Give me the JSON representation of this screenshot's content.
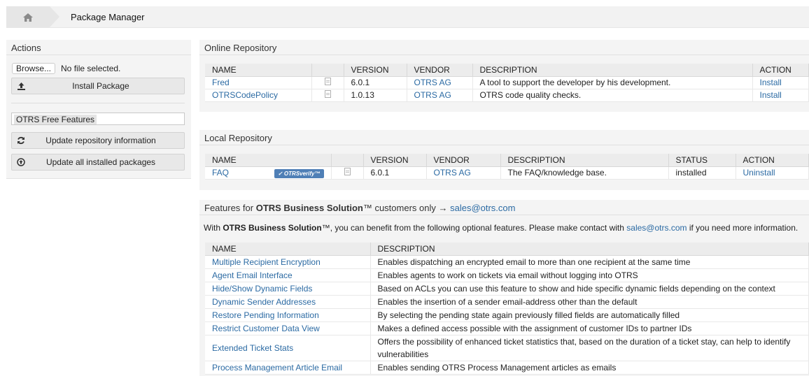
{
  "breadcrumb": {
    "title": "Package Manager",
    "home_icon": "home-icon"
  },
  "sidebar": {
    "title": "Actions",
    "browse_label": "Browse...",
    "no_file": "No file selected.",
    "install_label": "Install Package",
    "repo_select": "OTRS Free Features",
    "update_repo_label": "Update repository information",
    "update_all_label": "Update all installed packages"
  },
  "online": {
    "title": "Online Repository",
    "headers": [
      "NAME",
      "",
      "VERSION",
      "VENDOR",
      "DESCRIPTION",
      "ACTION"
    ],
    "rows": [
      {
        "name": "Fred",
        "version": "6.0.1",
        "vendor": "OTRS AG",
        "description": "A tool to support the developer by his development.",
        "action": "Install"
      },
      {
        "name": "OTRSCodePolicy",
        "version": "1.0.13",
        "vendor": "OTRS AG",
        "description": "OTRS code quality checks.",
        "action": "Install"
      }
    ]
  },
  "local": {
    "title": "Local Repository",
    "headers": [
      "NAME",
      "",
      "VERSION",
      "VENDOR",
      "DESCRIPTION",
      "STATUS",
      "ACTION"
    ],
    "rows": [
      {
        "name": "FAQ",
        "badge": "✓ OTRSverify™",
        "version": "6.0.1",
        "vendor": "OTRS AG",
        "description": "The FAQ/knowledge base.",
        "status": "installed",
        "action": "Uninstall"
      }
    ]
  },
  "features": {
    "title_prefix": "Features for ",
    "title_bold": "OTRS Business Solution",
    "title_suffix": "™ customers only → ",
    "title_link": "sales@otrs.com",
    "intro_prefix": "With ",
    "intro_bold": "OTRS Business Solution",
    "intro_mid": "™, you can benefit from the following optional features. Please make contact with ",
    "intro_link": "sales@otrs.com",
    "intro_suffix": " if you need more information.",
    "headers": [
      "NAME",
      "DESCRIPTION"
    ],
    "rows": [
      {
        "name": "Multiple Recipient Encryption",
        "description": "Enables dispatching an encrypted email to more than one recipient at the same time"
      },
      {
        "name": "Agent Email Interface",
        "description": "Enables agents to work on tickets via email without logging into OTRS"
      },
      {
        "name": "Hide/Show Dynamic Fields",
        "description": "Based on ACLs you can use this feature to show and hide specific dynamic fields depending on the context"
      },
      {
        "name": "Dynamic Sender Addresses",
        "description": "Enables the insertion of a sender email-address other than the default"
      },
      {
        "name": "Restore Pending Information",
        "description": "By selecting the pending state again previously filled fields are automatically filled"
      },
      {
        "name": "Restrict Customer Data View",
        "description": "Makes a defined access possible with the assignment of customer IDs to partner IDs"
      },
      {
        "name": "Extended Ticket Stats",
        "description": "Offers the possibility of enhanced ticket statistics that, based on the duration of a ticket stay, can help to identify vulnerabilities"
      },
      {
        "name": "Process Management Article Email",
        "description": "Enables sending OTRS Process Management articles as emails"
      }
    ]
  }
}
